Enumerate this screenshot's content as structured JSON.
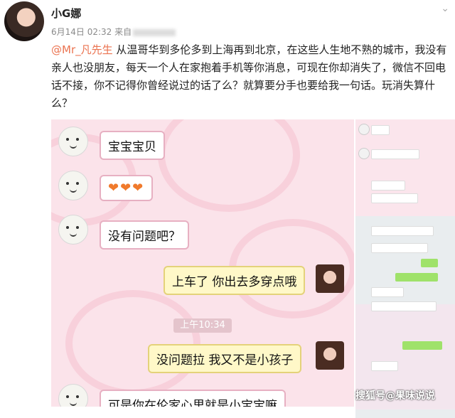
{
  "post": {
    "username": "小G娜",
    "date": "6月14日 02:32 来自",
    "mention": "@Mr_凡先生",
    "body": " 从温哥华到多伦多到上海再到北京，在这些人生地不熟的城市，我没有亲人也没朋友，每天一个人在家抱着手机等你消息，可现在你却消失了，微信不回电话不接，你不记得你曾经说过的话了么？就算要分手也要给我一句话。玩消失算什么？"
  },
  "chat": {
    "messages": [
      {
        "side": "left",
        "text": "宝宝宝贝"
      },
      {
        "side": "left",
        "text": "❤❤❤"
      },
      {
        "side": "left",
        "text": "没有问题吧？"
      },
      {
        "side": "right",
        "text": "上车了 你出去多穿点哦"
      },
      {
        "side": "right",
        "text": "没问题拉 我又不是小孩子"
      },
      {
        "side": "left",
        "text": "可是你在伦家心里就是小宝宝嘛"
      }
    ],
    "timestamp": "上午10:34"
  },
  "watermark": "搜狐号@果味说说",
  "colors": {
    "mention": "#eb7350",
    "chat_bg": "#fbe3ea",
    "my_bubble": "#fff8c8"
  }
}
